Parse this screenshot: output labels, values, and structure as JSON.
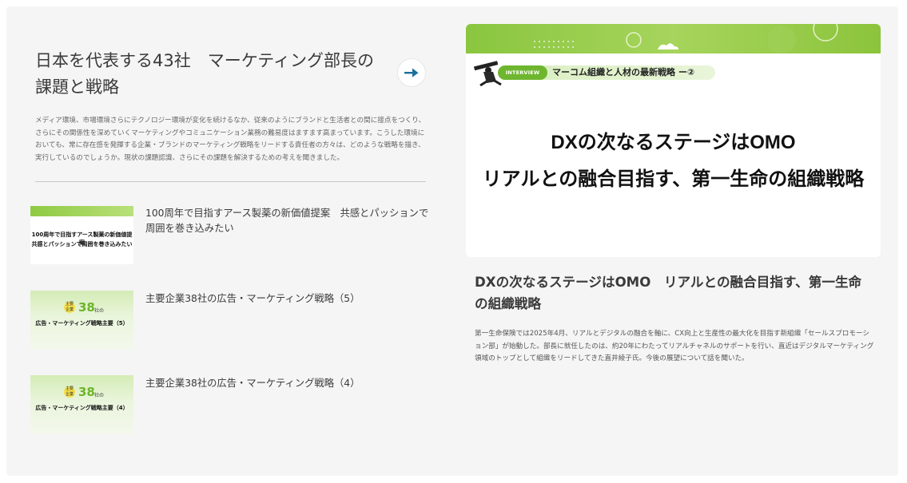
{
  "feature": {
    "title": "日本を代表する43社　マーケティング部長の課題と戦略",
    "description": "メディア環境、市場環境さらにテクノロジー環境が変化を続けるなか、従来のようにブランドと生活者との間に接点をつくり、さらにその関係性を深めていくマーケティングやコミュニケーション業務の難易度はますます高まっています。こうした環境においても、常に存在感を発揮する企業・ブランドのマーケティング戦略をリードする責任者の方々は、どのような戦略を描き、実行しているのでしょうか。現状の課題認識、さらにその課題を解決するための考えを聞きました。"
  },
  "articles": [
    {
      "title": "100周年で目指すアース製薬の新価値提案　共感とパッションで周囲を巻き込みたい",
      "thumb_line1": "100周年で目指すアース製薬の新価値提案",
      "thumb_line2": "共感とパッションで周囲を巻き込みたい"
    },
    {
      "title": "主要企業38社の広告・マーケティング戦略（5）",
      "thumb_badge": "主要企業",
      "thumb_num": "38",
      "thumb_suffix": "社の",
      "thumb_caption": "広告・マーケティング戦略主要（5）"
    },
    {
      "title": "主要企業38社の広告・マーケティング戦略（4）",
      "thumb_badge": "主要企業",
      "thumb_num": "38",
      "thumb_suffix": "社の",
      "thumb_caption": "広告・マーケティング戦略主要（4）"
    }
  ],
  "main": {
    "interview_badge": "INTERVIEW",
    "series_label": "マーコム組織と人材の最新戦略 ー②",
    "image_headline_1": "DXの次なるステージはOMO",
    "image_headline_2": "リアルとの融合目指す、第一生命の組織戦略",
    "title": "DXの次なるステージはOMO　リアルとの融合目指す、第一生命の組織戦略",
    "description": "第一生命保険では2025年4月、リアルとデジタルの融合を軸に、CX向上と生産性の最大化を目指す新組織「セールスプロモーション部」が始動した。部長に就任したのは、約20年にわたってリアルチャネルのサポートを行い、直近はデジタルマーケティング領域のトップとして組織をリードしてきた直井綾子氏。今後の展望について話を聞いた。"
  },
  "icons": {
    "arrow": "arrow-right-icon"
  },
  "colors": {
    "accent_green": "#8ac63f",
    "arrow_blue": "#1d6f9c",
    "panel_bg": "#f5f5f5"
  }
}
